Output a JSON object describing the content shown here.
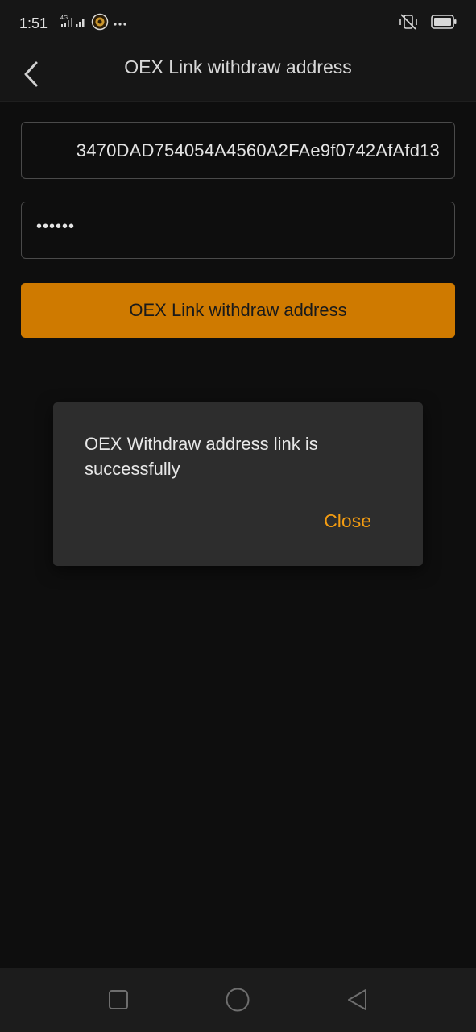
{
  "status_bar": {
    "time": "1:51",
    "network_type": "4G",
    "icons": [
      "signal-icon",
      "app-notification-icon",
      "more-dots-icon",
      "vibrate-off-icon",
      "battery-icon"
    ]
  },
  "header": {
    "back_icon": "chevron-left-icon",
    "title": "OEX Link withdraw address"
  },
  "form": {
    "address_value": "3470DAD754054A4560A2FAe9f0742AfAfd13",
    "password_value": "••••••",
    "submit_label": "OEX Link withdraw address"
  },
  "dialog": {
    "message": "OEX Withdraw address link is successfully",
    "close_label": "Close"
  },
  "nav_bar": {
    "icons": [
      "recent-apps-icon",
      "home-icon",
      "back-triangle-icon"
    ]
  },
  "colors": {
    "accent": "#cf7a00",
    "dialog_action": "#f39c12",
    "background": "#0e0e0e",
    "dialog_background": "#2d2d2d"
  }
}
